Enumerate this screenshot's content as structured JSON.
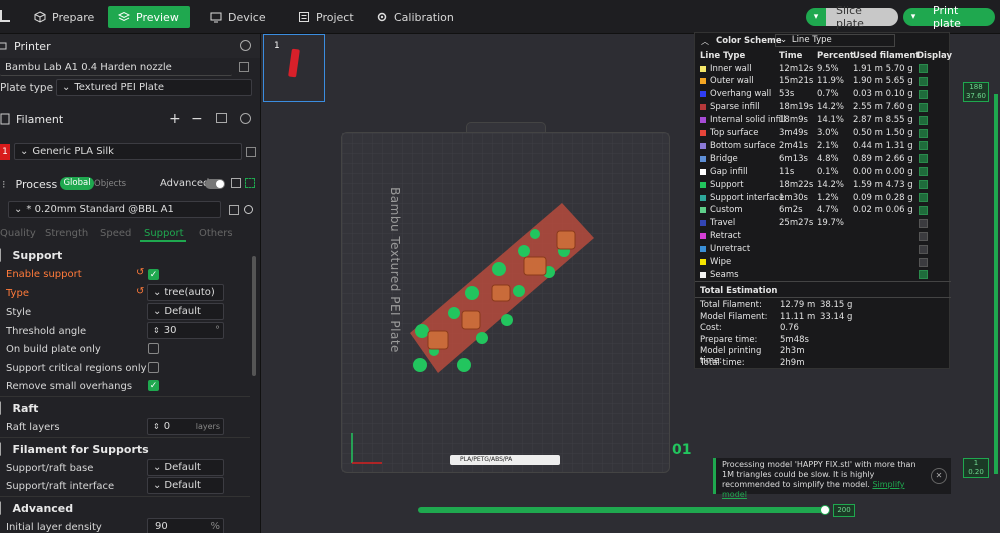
{
  "topbar": {
    "tabs": [
      {
        "label": "Prepare",
        "icon": "cube-icon"
      },
      {
        "label": "Preview",
        "icon": "layers-icon"
      },
      {
        "label": "Device",
        "icon": "monitor-icon"
      },
      {
        "label": "Project",
        "icon": "list-icon"
      },
      {
        "label": "Calibration",
        "icon": "gear-icon"
      }
    ],
    "slice_label": "Slice plate",
    "print_label": "Print plate"
  },
  "left": {
    "printer_title": "Printer",
    "printer_value": "Bambu Lab A1 0.4 Harden nozzle",
    "plate_type_label": "Plate type",
    "plate_type_value": "Textured PEI Plate",
    "filament_title": "Filament",
    "filament_index": "1",
    "filament_value": "Generic PLA Silk",
    "process_title": "Process",
    "global_label": "Global",
    "objects_label": "Objects",
    "advanced_label": "Advanced",
    "process_value": "* 0.20mm Standard @BBL A1",
    "subtabs": [
      "Quality",
      "Strength",
      "Speed",
      "Support",
      "Others"
    ],
    "support_section": "Support",
    "support_rows": [
      {
        "label": "Enable support",
        "checked": true
      },
      {
        "label": "Type",
        "value": "tree(auto)"
      },
      {
        "label": "Style",
        "value": "Default"
      },
      {
        "label": "Threshold angle",
        "value": "30",
        "unit": "°"
      },
      {
        "label": "On build plate only",
        "checked": false
      },
      {
        "label": "Support critical regions only",
        "checked": false
      },
      {
        "label": "Remove small overhangs",
        "checked": true
      }
    ],
    "raft_section": "Raft",
    "raft_layers_label": "Raft layers",
    "raft_layers_value": "0",
    "raft_layers_unit": "layers",
    "filsup_section": "Filament for Supports",
    "support_base_label": "Support/raft base",
    "support_base_value": "Default",
    "support_iface_label": "Support/raft interface",
    "support_iface_value": "Default",
    "advanced_section": "Advanced",
    "init_density_label": "Initial layer density",
    "init_density_value": "90",
    "init_density_unit": "%"
  },
  "viewport": {
    "thumb_index": "1",
    "plate_text": "Bambu Textured PEI Plate",
    "plate_footer": "PLA/PETG/ABS/PA",
    "layer_top": "188",
    "layer_top_height": "37.60",
    "layer_bottom": "1",
    "layer_bottom_height": "0.20",
    "plate_number": "01",
    "slider_value": "200"
  },
  "legend": {
    "scheme_label": "Color Scheme",
    "scheme_value": "Line Type",
    "headers": [
      "Line Type",
      "Time",
      "Percent",
      "Used filament",
      "Display"
    ],
    "rows": [
      {
        "name": "Inner wall",
        "time": "12m12s",
        "percent": "9.5%",
        "used": "1.91 m  5.70 g",
        "color": "#f4e66a",
        "on": true
      },
      {
        "name": "Outer wall",
        "time": "15m21s",
        "percent": "11.9%",
        "used": "1.90 m  5.65 g",
        "color": "#f5a623",
        "on": true
      },
      {
        "name": "Overhang wall",
        "time": "53s",
        "percent": "0.7%",
        "used": "0.03 m  0.10 g",
        "color": "#2f3df5",
        "on": true
      },
      {
        "name": "Sparse infill",
        "time": "18m19s",
        "percent": "14.2%",
        "used": "2.55 m  7.60 g",
        "color": "#b6383a",
        "on": true
      },
      {
        "name": "Internal solid infill",
        "time": "18m9s",
        "percent": "14.1%",
        "used": "2.87 m  8.55 g",
        "color": "#a64bd6",
        "on": true
      },
      {
        "name": "Top surface",
        "time": "3m49s",
        "percent": "3.0%",
        "used": "0.50 m  1.50 g",
        "color": "#e6453a",
        "on": true
      },
      {
        "name": "Bottom surface",
        "time": "2m41s",
        "percent": "2.1%",
        "used": "0.44 m  1.31 g",
        "color": "#8c7ad8",
        "on": true
      },
      {
        "name": "Bridge",
        "time": "6m13s",
        "percent": "4.8%",
        "used": "0.89 m  2.66 g",
        "color": "#5e8fd6",
        "on": true
      },
      {
        "name": "Gap infill",
        "time": "11s",
        "percent": "0.1%",
        "used": "0.00 m  0.00 g",
        "color": "#ffffff",
        "on": true
      },
      {
        "name": "Support",
        "time": "18m22s",
        "percent": "14.2%",
        "used": "1.59 m  4.73 g",
        "color": "#22c55e",
        "on": true
      },
      {
        "name": "Support interface",
        "time": "1m30s",
        "percent": "1.2%",
        "used": "0.09 m  0.28 g",
        "color": "#2ea89a",
        "on": true
      },
      {
        "name": "Custom",
        "time": "6m2s",
        "percent": "4.7%",
        "used": "0.02 m  0.06 g",
        "color": "#5fcf8a",
        "on": true
      },
      {
        "name": "Travel",
        "time": "25m27s",
        "percent": "19.7%",
        "used": "",
        "color": "#3346b5",
        "on": false
      },
      {
        "name": "Retract",
        "time": "",
        "percent": "",
        "used": "",
        "color": "#d63fd6",
        "on": false
      },
      {
        "name": "Unretract",
        "time": "",
        "percent": "",
        "used": "",
        "color": "#3a8fd6",
        "on": false
      },
      {
        "name": "Wipe",
        "time": "",
        "percent": "",
        "used": "",
        "color": "#f5e400",
        "on": false
      },
      {
        "name": "Seams",
        "time": "",
        "percent": "",
        "used": "",
        "color": "#f2f2f2",
        "on": true
      }
    ],
    "estimation_title": "Total Estimation",
    "estimation": [
      {
        "k": "Total Filament:",
        "v1": "12.79 m",
        "v2": "38.15 g"
      },
      {
        "k": "Model Filament:",
        "v1": "11.11 m",
        "v2": "33.14 g"
      },
      {
        "k": "Cost:",
        "v1": "0.76",
        "v2": ""
      },
      {
        "k": "Prepare time:",
        "v1": "5m48s",
        "v2": ""
      },
      {
        "k": "Model printing time:",
        "v1": "2h3m",
        "v2": ""
      },
      {
        "k": "Total time:",
        "v1": "2h9m",
        "v2": ""
      }
    ]
  },
  "notice": {
    "text": "Processing model 'HAPPY FIX.stl' with more than 1M triangles could be slow. It is highly recommended to simplify the model.",
    "link": "Simplify model"
  },
  "colors": {
    "accent": "#1fa84f",
    "model": "#c96b3a",
    "support": "#22c55e",
    "plate_base": "#b64b3d"
  }
}
